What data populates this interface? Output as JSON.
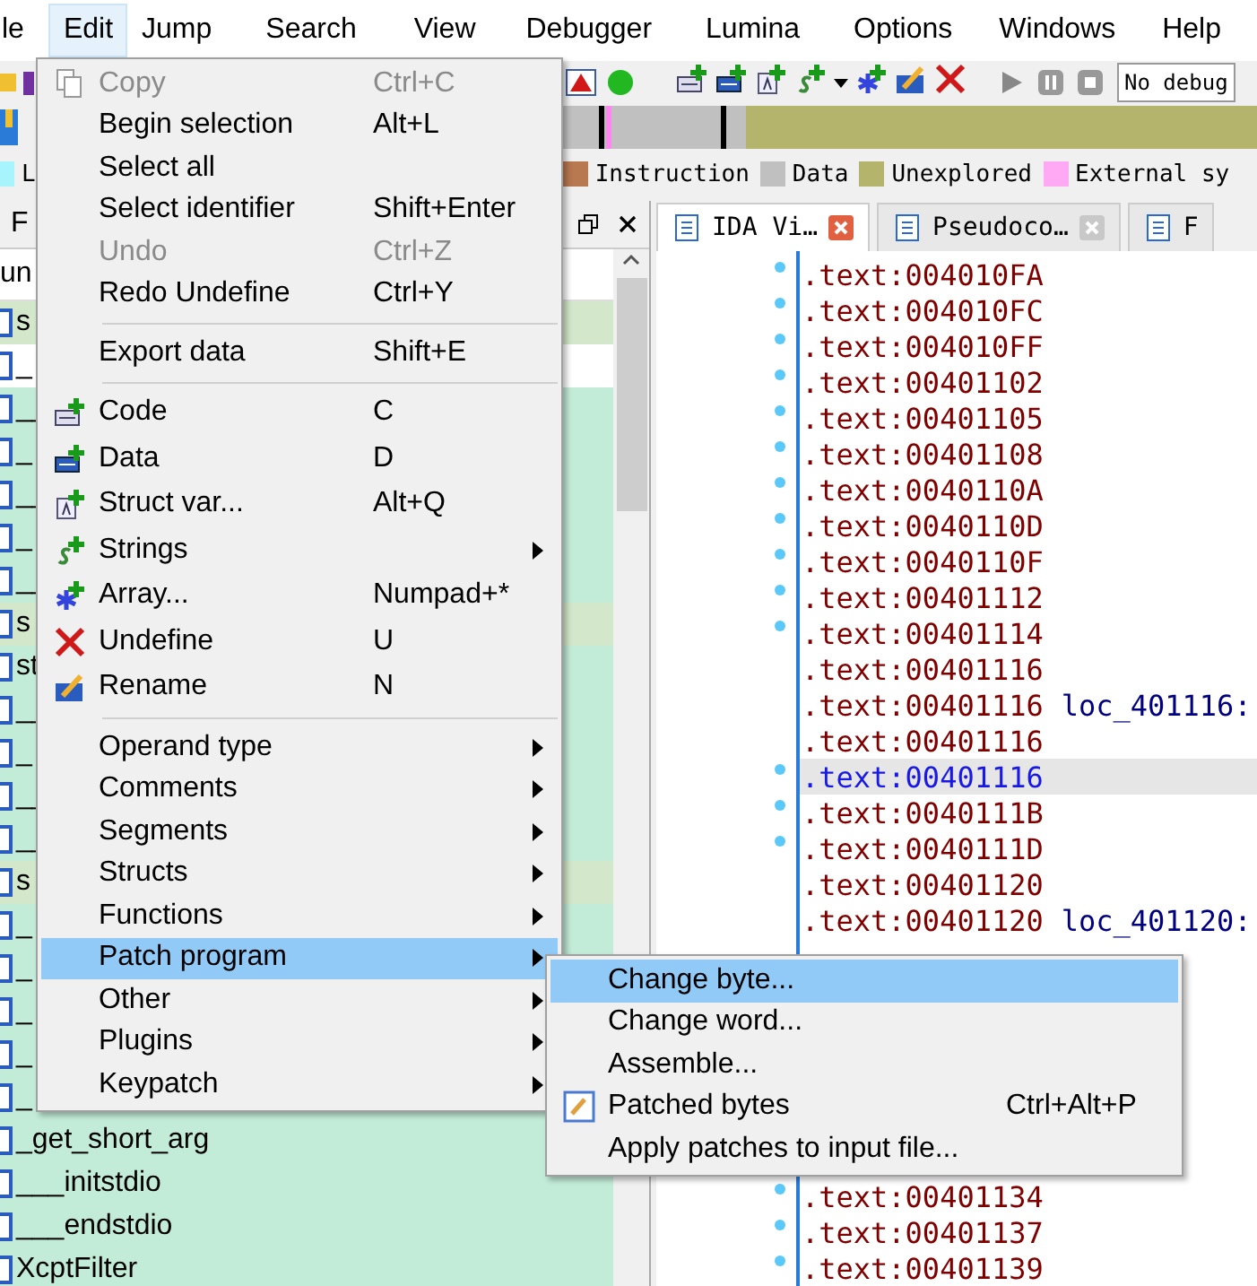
{
  "menubar": [
    {
      "label": "le",
      "selected": false
    },
    {
      "label": "Edit",
      "selected": true
    },
    {
      "label": "Jump",
      "selected": false
    },
    {
      "label": "Search",
      "selected": false
    },
    {
      "label": "View",
      "selected": false
    },
    {
      "label": "Debugger",
      "selected": false
    },
    {
      "label": "Lumina",
      "selected": false
    },
    {
      "label": "Options",
      "selected": false
    },
    {
      "label": "Windows",
      "selected": false
    },
    {
      "label": "Help",
      "selected": false
    }
  ],
  "debugger_select": {
    "value": "No debug"
  },
  "legend": {
    "left": [
      {
        "label": "L",
        "color": "#a8f4fc"
      }
    ],
    "right": [
      {
        "label": "Instruction",
        "color": "#b87850"
      },
      {
        "label": "Data",
        "color": "#c0c0c0"
      },
      {
        "label": "Unexplored",
        "color": "#b4b46c"
      },
      {
        "label": "External sy",
        "color": "#ffa8f4"
      }
    ]
  },
  "functions_panel": {
    "title": "F",
    "column": "un",
    "rows": [
      {
        "name": "s",
        "kind": "regular"
      },
      {
        "name": "_",
        "kind": "plain"
      },
      {
        "name": "__",
        "kind": "library"
      },
      {
        "name": "_",
        "kind": "library"
      },
      {
        "name": "__",
        "kind": "library"
      },
      {
        "name": "_",
        "kind": "library"
      },
      {
        "name": "__",
        "kind": "library"
      },
      {
        "name": "s",
        "kind": "regular"
      },
      {
        "name": "st",
        "kind": "library"
      },
      {
        "name": "__",
        "kind": "library"
      },
      {
        "name": "_",
        "kind": "library"
      },
      {
        "name": "__",
        "kind": "library"
      },
      {
        "name": "__",
        "kind": "library"
      },
      {
        "name": "s",
        "kind": "regular"
      },
      {
        "name": "_",
        "kind": "library"
      },
      {
        "name": "_",
        "kind": "library"
      },
      {
        "name": "_",
        "kind": "library"
      },
      {
        "name": "_",
        "kind": "library"
      },
      {
        "name": "_",
        "kind": "library"
      },
      {
        "name": "_get_short_arg",
        "kind": "library"
      },
      {
        "name": "___initstdio",
        "kind": "library"
      },
      {
        "name": "___endstdio",
        "kind": "library"
      },
      {
        "name": "XcptFilter",
        "kind": "library"
      }
    ]
  },
  "tabs": [
    {
      "label": "IDA Vi…",
      "selected": true
    },
    {
      "label": "Pseudoco…",
      "selected": false
    },
    {
      "label": "F",
      "selected": false
    }
  ],
  "listing": {
    "lines_top": [
      {
        "address": ".text:004010FA",
        "dot": true,
        "selected": false
      },
      {
        "address": ".text:004010FC",
        "dot": true,
        "selected": false
      },
      {
        "address": ".text:004010FF",
        "dot": true,
        "selected": false
      },
      {
        "address": ".text:00401102",
        "dot": true,
        "selected": false
      },
      {
        "address": ".text:00401105",
        "dot": true,
        "selected": false
      },
      {
        "address": ".text:00401108",
        "dot": true,
        "selected": false
      },
      {
        "address": ".text:0040110A",
        "dot": true,
        "selected": false
      },
      {
        "address": ".text:0040110D",
        "dot": true,
        "selected": false
      },
      {
        "address": ".text:0040110F",
        "dot": true,
        "selected": false
      },
      {
        "address": ".text:00401112",
        "dot": true,
        "selected": false
      },
      {
        "address": ".text:00401114",
        "dot": true,
        "selected": false
      },
      {
        "address": ".text:00401116",
        "dot": false,
        "selected": false
      },
      {
        "address": ".text:00401116",
        "label": "loc_401116:",
        "dot": false,
        "selected": false
      },
      {
        "address": ".text:00401116",
        "dot": false,
        "selected": false
      },
      {
        "address": ".text:00401116",
        "dot": true,
        "selected": true
      },
      {
        "address": ".text:0040111B",
        "dot": true,
        "selected": false
      },
      {
        "address": ".text:0040111D",
        "dot": true,
        "selected": false
      },
      {
        "address": ".text:00401120",
        "dot": false,
        "selected": false
      },
      {
        "address": ".text:00401120",
        "label": "loc_401120:",
        "dot": false,
        "selected": false
      }
    ],
    "lines_bottom": [
      {
        "address": ".text:00401134",
        "dot": true,
        "selected": false
      },
      {
        "address": ".text:00401137",
        "dot": true,
        "selected": false
      },
      {
        "address": ".text:00401139",
        "dot": true,
        "selected": false
      }
    ]
  },
  "edit_menu": [
    {
      "kind": "copy",
      "label": "Copy",
      "shortcut": "Ctrl+C",
      "disabled": true,
      "selected": false,
      "submenu": false
    },
    {
      "kind": "plain",
      "label": "Begin selection",
      "shortcut": "Alt+L",
      "disabled": false,
      "selected": false,
      "submenu": false
    },
    {
      "kind": "plain",
      "label": "Select all",
      "disabled": false,
      "selected": false,
      "submenu": false
    },
    {
      "kind": "plain",
      "label": "Select identifier",
      "shortcut": "Shift+Enter",
      "disabled": false,
      "selected": false,
      "submenu": false
    },
    {
      "kind": "plain",
      "label": "Undo",
      "shortcut": "Ctrl+Z",
      "disabled": true,
      "selected": false,
      "submenu": false
    },
    {
      "kind": "plain",
      "label": "Redo Undefine",
      "shortcut": "Ctrl+Y",
      "disabled": false,
      "selected": false,
      "submenu": false
    },
    {
      "kind": "separator"
    },
    {
      "kind": "plain",
      "label": "Export data",
      "shortcut": "Shift+E",
      "disabled": false,
      "selected": false,
      "submenu": false
    },
    {
      "kind": "separator"
    },
    {
      "kind": "code",
      "label": "Code",
      "shortcut": "C",
      "disabled": false,
      "selected": false,
      "submenu": false
    },
    {
      "kind": "data",
      "label": "Data",
      "shortcut": "D",
      "disabled": false,
      "selected": false,
      "submenu": false
    },
    {
      "kind": "struct",
      "label": "Struct var...",
      "shortcut": "Alt+Q",
      "disabled": false,
      "selected": false,
      "submenu": false
    },
    {
      "kind": "strings",
      "label": "Strings",
      "disabled": false,
      "selected": false,
      "submenu": true
    },
    {
      "kind": "array",
      "label": "Array...",
      "shortcut": "Numpad+*",
      "disabled": false,
      "selected": false,
      "submenu": false
    },
    {
      "kind": "undefine",
      "label": "Undefine",
      "shortcut": "U",
      "disabled": false,
      "selected": false,
      "submenu": false
    },
    {
      "kind": "rename",
      "label": "Rename",
      "shortcut": "N",
      "disabled": false,
      "selected": false,
      "submenu": false
    },
    {
      "kind": "separator"
    },
    {
      "kind": "plain",
      "label": "Operand type",
      "disabled": false,
      "selected": false,
      "submenu": true
    },
    {
      "kind": "plain",
      "label": "Comments",
      "disabled": false,
      "selected": false,
      "submenu": true
    },
    {
      "kind": "plain",
      "label": "Segments",
      "disabled": false,
      "selected": false,
      "submenu": true
    },
    {
      "kind": "plain",
      "label": "Structs",
      "disabled": false,
      "selected": false,
      "submenu": true
    },
    {
      "kind": "plain",
      "label": "Functions",
      "disabled": false,
      "selected": false,
      "submenu": true
    },
    {
      "kind": "plain",
      "label": "Patch program",
      "disabled": false,
      "selected": true,
      "submenu": true
    },
    {
      "kind": "plain",
      "label": "Other",
      "disabled": false,
      "selected": false,
      "submenu": true
    },
    {
      "kind": "plain",
      "label": "Plugins",
      "disabled": false,
      "selected": false,
      "submenu": true
    },
    {
      "kind": "plain",
      "label": "Keypatch",
      "disabled": false,
      "selected": false,
      "submenu": true
    }
  ],
  "patch_submenu": [
    {
      "kind": "plain",
      "label": "Change byte...",
      "disabled": false,
      "selected": true,
      "submenu": false
    },
    {
      "kind": "plain",
      "label": "Change word...",
      "disabled": false,
      "selected": false,
      "submenu": false
    },
    {
      "kind": "plain",
      "label": "Assemble...",
      "disabled": false,
      "selected": false,
      "submenu": false
    },
    {
      "kind": "patched",
      "label": "Patched bytes",
      "shortcut": "Ctrl+Alt+P",
      "disabled": false,
      "selected": false,
      "submenu": false
    },
    {
      "kind": "plain",
      "label": "Apply patches to input file...",
      "disabled": false,
      "selected": false,
      "submenu": false
    }
  ]
}
